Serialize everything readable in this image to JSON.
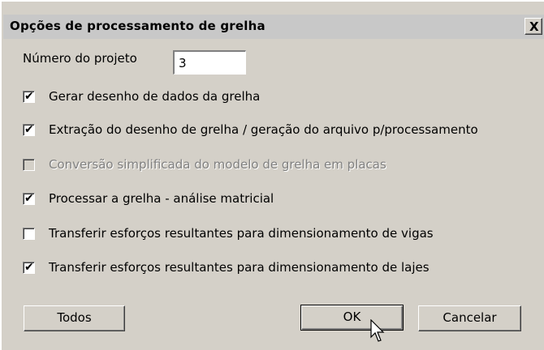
{
  "dialog": {
    "title": "Opções de processamento de grelha",
    "close_glyph": "X"
  },
  "project": {
    "label": "Número do projeto",
    "value": "3"
  },
  "options": [
    {
      "label": "Gerar desenho de dados da grelha",
      "checked": true,
      "enabled": true
    },
    {
      "label": "Extração do desenho de grelha / geração do arquivo p/processamento",
      "checked": true,
      "enabled": true
    },
    {
      "label": "Conversão simplificada do modelo de grelha em placas",
      "checked": false,
      "enabled": false
    },
    {
      "label": "Processar a grelha - análise matricial",
      "checked": true,
      "enabled": true
    },
    {
      "label": "Transferir esforços resultantes para dimensionamento de vigas",
      "checked": false,
      "enabled": true
    },
    {
      "label": "Transferir esforços resultantes para dimensionamento de lajes",
      "checked": true,
      "enabled": true
    }
  ],
  "check_glyph": "✔",
  "buttons": {
    "all": "Todos",
    "ok": "OK",
    "cancel": "Cancelar"
  }
}
